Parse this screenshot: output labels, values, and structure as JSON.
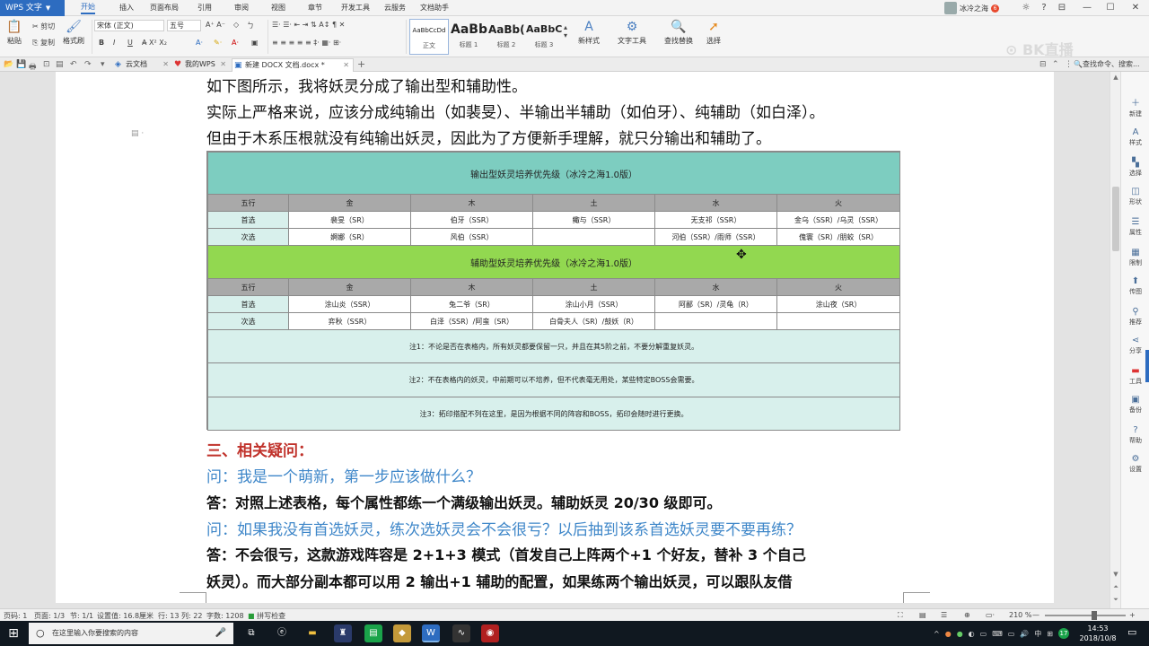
{
  "app": {
    "name": "WPS 文字"
  },
  "menu_tabs": [
    "开始",
    "插入",
    "页面布局",
    "引用",
    "审阅",
    "视图",
    "章节",
    "开发工具",
    "云服务",
    "文档助手"
  ],
  "user": {
    "name": "冰冷之海",
    "badge": "6"
  },
  "window_controls": {
    "skin": "☼",
    "help": "?",
    "min": "—",
    "max": "☐",
    "close": "✕",
    "option": "⊟"
  },
  "ribbon": {
    "paste": "粘贴",
    "cut": "剪切",
    "copy": "复制",
    "format_painter": "格式刷",
    "font_name": "宋体 (正文)",
    "font_size": "五号",
    "bold": "B",
    "italic": "I",
    "underline": "U",
    "styles": [
      {
        "sample": "AaBbCcDd",
        "label": "正文"
      },
      {
        "sample": "AaBb",
        "label": "标题 1"
      },
      {
        "sample": "AaBb(",
        "label": "标题 2"
      },
      {
        "sample": "AaBbC",
        "label": "标题 3"
      }
    ],
    "new_style": "新样式",
    "text_tools": "文字工具",
    "find_replace": "查找替换",
    "select": "选择"
  },
  "tabs": [
    {
      "label": "云文档"
    },
    {
      "label": "我的WPS"
    },
    {
      "label": "新建 DOCX 文档.docx *"
    }
  ],
  "search_cmd": "查找命令、搜索...",
  "watermark": "⊙ BK直播",
  "document": {
    "lines_top": [
      "如下图所示，我将妖灵分成了输出型和辅助性。",
      "实际上严格来说，应该分成纯输出（如裴旻）、半输出半辅助（如伯牙）、纯辅助（如白泽）。",
      "但由于木系压根就没有纯输出妖灵，因此为了方便新手理解，就只分输出和辅助了。"
    ],
    "table": {
      "title_output": "输出型妖灵培养优先级（冰冷之海1.0版）",
      "title_support": "辅助型妖灵培养优先级（冰冷之海1.0版）",
      "header": [
        "五行",
        "金",
        "木",
        "土",
        "水",
        "火"
      ],
      "output_rows": [
        [
          "首选",
          "裴旻（SR）",
          "伯牙（SSR）",
          "鲰与（SSR）",
          "无支祁（SSR）",
          "金乌（SSR）/乌灵（SSR）"
        ],
        [
          "次选",
          "婀娜（SR）",
          "风伯（SSR）",
          "",
          "河伯（SSR）/雨师（SSR）",
          "傀寰（SR）/朋蛟（SR）"
        ]
      ],
      "support_rows": [
        [
          "首选",
          "涂山炎（SSR）",
          "兔二爷（SR）",
          "涂山小月（SSR）",
          "阿鄙（SR）/灵龟（R）",
          "涂山夜（SR）"
        ],
        [
          "次选",
          "弈秋（SSR）",
          "白泽（SSR）/阿蛮（SR）",
          "白骨夫人（SR）/鼓妖（R）",
          "",
          ""
        ]
      ],
      "notes": [
        "注1：不论是否在表格内，所有妖灵都要保留一只，并且在其5阶之前，不要分解重复妖灵。",
        "注2：不在表格内的妖灵，中前期可以不培养，但不代表毫无用处，某些特定BOSS会需要。",
        "注3：拓印搭配不列在这里，是因为根据不同的阵容和BOSS，拓印会随时进行更换。"
      ]
    },
    "heading": "三、相关疑问：",
    "qa_lines": [
      {
        "kind": "q",
        "text": "问：我是一个萌新，第一步应该做什么？"
      },
      {
        "kind": "a",
        "text": "答：对照上述表格，每个属性都练一个满级输出妖灵。辅助妖灵 20/30 级即可。"
      },
      {
        "kind": "q",
        "text": "问：如果我没有首选妖灵，练次选妖灵会不会很亏？以后抽到该系首选妖灵要不要再练？"
      },
      {
        "kind": "a",
        "text": "答：不会很亏，这款游戏阵容是 2+1+3 模式（首发自己上阵两个+1 个好友，替补 3 个自己"
      },
      {
        "kind": "a",
        "text": "妖灵）。而大部分副本都可以用 2 输出+1 辅助的配置，如果练两个输出妖灵，可以跟队友借"
      }
    ]
  },
  "side_panel": [
    "新建",
    "样式",
    "选择",
    "形状",
    "属性",
    "限制",
    "传图",
    "推荐",
    "分享",
    "工具",
    "备份",
    "帮助",
    "设置"
  ],
  "status": {
    "page": "页码: 1",
    "pages": "页面: 1/3",
    "section": "节: 1/1",
    "position": "设置值: 16.8厘米",
    "line": "行: 13",
    "column": "列: 22",
    "words": "字数: 1208",
    "spell": "拼写检查",
    "zoom": "210 %"
  },
  "taskbar": {
    "search_placeholder": "在这里输入你要搜索的内容",
    "time": "14:53",
    "date": "2018/10/8",
    "notif_count": "17"
  }
}
